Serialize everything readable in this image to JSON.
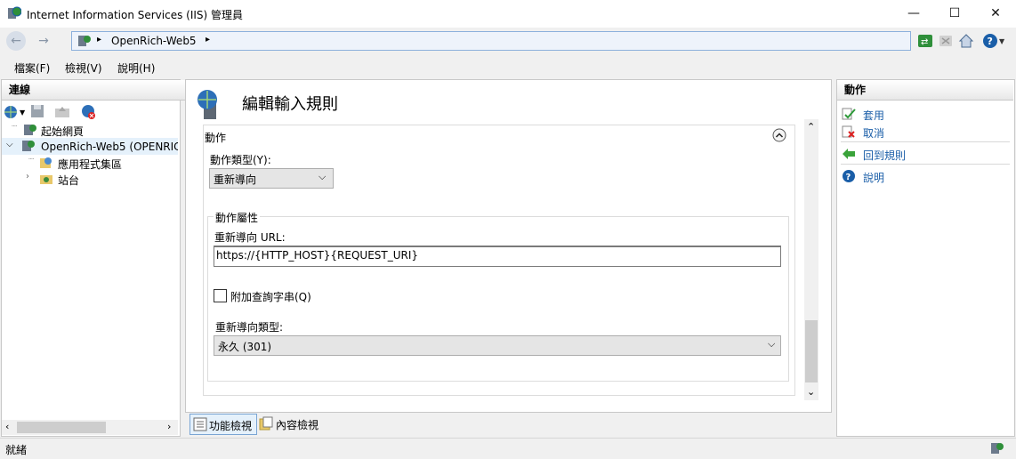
{
  "window": {
    "title": "Internet Information Services (IIS) 管理員",
    "minimize": "—",
    "maximize": "☐",
    "close": "✕"
  },
  "address": {
    "path": "OpenRich-Web5",
    "separator": "▸"
  },
  "menu": [
    {
      "label": "檔案(F)"
    },
    {
      "label": "檢視(V)"
    },
    {
      "label": "說明(H)"
    }
  ],
  "connections": {
    "header": "連線",
    "tree": [
      {
        "label": "起始網頁",
        "icon": "start-page-icon"
      },
      {
        "label": "OpenRich-Web5 (OPENRIC",
        "icon": "server-icon",
        "selected": true
      },
      {
        "label": "應用程式集區",
        "icon": "app-pool-icon"
      },
      {
        "label": "站台",
        "icon": "sites-folder-icon"
      }
    ]
  },
  "center": {
    "heading": "編輯輸入規則",
    "section_title": "動作",
    "action_type_label": "動作類型(Y):",
    "action_type_value": "重新導向",
    "props_group_label": "動作屬性",
    "redirect_url_label": "重新導向 URL:",
    "redirect_url_value": "https://{HTTP_HOST}{REQUEST_URI}",
    "append_query_label": "附加查詢字串(Q)",
    "append_query_checked": false,
    "redirect_type_label": "重新導向類型:",
    "redirect_type_value": "永久 (301)"
  },
  "bottom_tabs": [
    {
      "label": "功能檢視"
    },
    {
      "label": "內容檢視"
    }
  ],
  "actions": {
    "header": "動作",
    "items": [
      {
        "label": "套用",
        "icon": "apply-check-icon"
      },
      {
        "label": "取消",
        "icon": "cancel-x-icon"
      },
      {
        "label": "回到規則",
        "icon": "back-arrow-icon"
      },
      {
        "label": "說明",
        "icon": "help-icon"
      }
    ]
  },
  "status": {
    "text": "就緒"
  },
  "colors": {
    "accent": "#1a5ea8",
    "selection": "#e5f1fb",
    "address_bg": "#eef3fb"
  }
}
